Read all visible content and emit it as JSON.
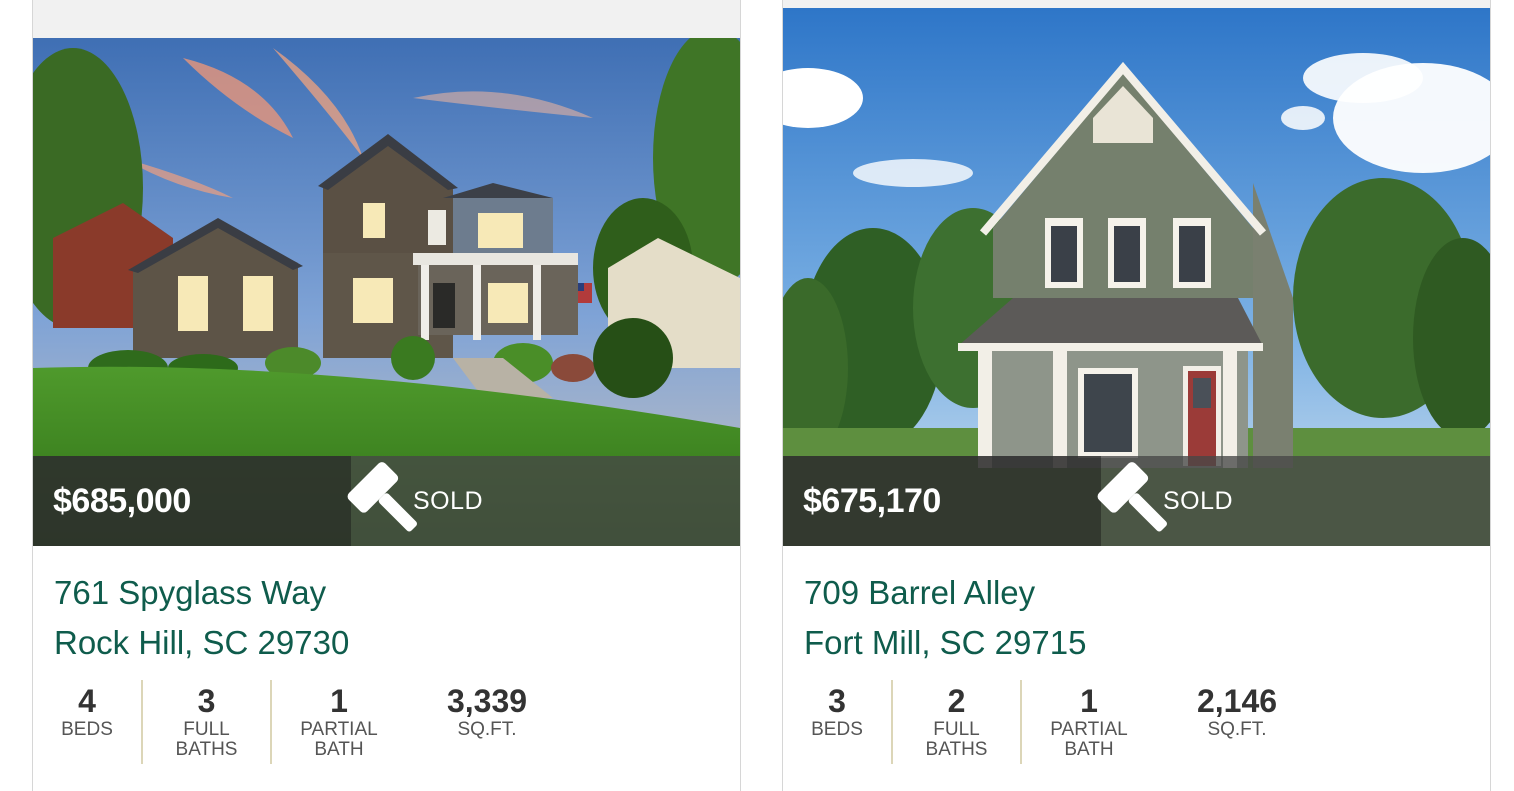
{
  "listings": [
    {
      "price": "$685,000",
      "status": "SOLD",
      "status_icon": "gavel-icon",
      "address_line1": "761 Spyglass Way",
      "address_line2": "Rock Hill, SC 29730",
      "stats": {
        "beds": {
          "value": "4",
          "label": "BEDS"
        },
        "full_baths": {
          "value": "3",
          "label1": "FULL",
          "label2": "BATHS"
        },
        "partial_bath": {
          "value": "1",
          "label1": "PARTIAL",
          "label2": "BATH"
        },
        "sqft": {
          "value": "3,339",
          "label": "SQ.FT."
        }
      }
    },
    {
      "price": "$675,170",
      "status": "SOLD",
      "status_icon": "gavel-icon",
      "address_line1": "709 Barrel Alley",
      "address_line2": "Fort Mill, SC 29715",
      "stats": {
        "beds": {
          "value": "3",
          "label": "BEDS"
        },
        "full_baths": {
          "value": "2",
          "label1": "FULL",
          "label2": "BATHS"
        },
        "partial_bath": {
          "value": "1",
          "label1": "PARTIAL",
          "label2": "BATH"
        },
        "sqft": {
          "value": "2,146",
          "label": "SQ.FT."
        }
      }
    }
  ],
  "colors": {
    "address_green": "#0f5c4c",
    "stat_divider": "#dcd6b8",
    "price_band": "#2d2d2d"
  }
}
